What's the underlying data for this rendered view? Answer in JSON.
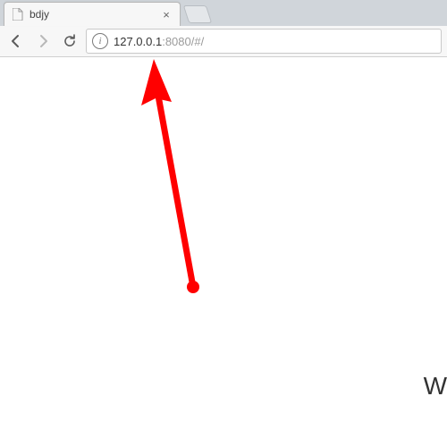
{
  "tab": {
    "title": "bdjy"
  },
  "address": {
    "host": "127.0.0.1",
    "port_and_path": ":8080/#/"
  },
  "page": {
    "visible_text": "W"
  },
  "annotation": {
    "color": "#ff0000"
  }
}
